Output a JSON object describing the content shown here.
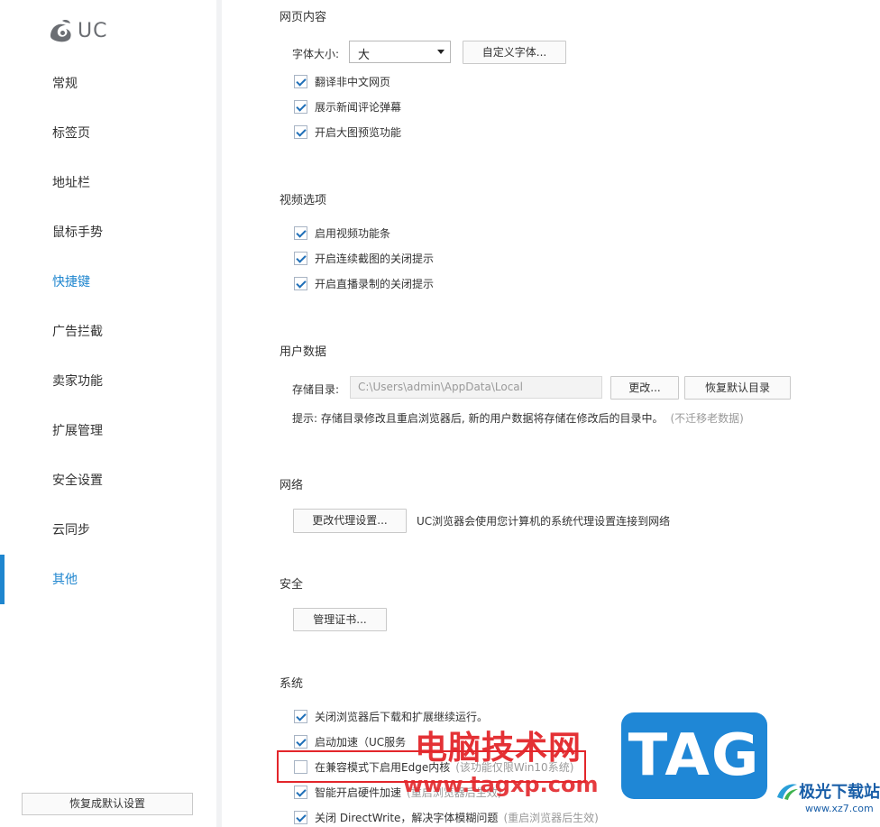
{
  "sidebar": {
    "logo_text": "UC",
    "items": [
      {
        "label": "常规"
      },
      {
        "label": "标签页"
      },
      {
        "label": "地址栏"
      },
      {
        "label": "鼠标手势"
      },
      {
        "label": "快捷键"
      },
      {
        "label": "广告拦截"
      },
      {
        "label": "卖家功能"
      },
      {
        "label": "扩展管理"
      },
      {
        "label": "安全设置"
      },
      {
        "label": "云同步"
      },
      {
        "label": "其他"
      }
    ],
    "active_item": "其他",
    "reset_button": "恢复成默认设置"
  },
  "webpage": {
    "title": "网页内容",
    "font_size_label": "字体大小:",
    "font_size_value": "大",
    "custom_font_button": "自定义字体...",
    "options": [
      {
        "label": "翻译非中文网页",
        "checked": true
      },
      {
        "label": "展示新闻评论弹幕",
        "checked": true
      },
      {
        "label": "开启大图预览功能",
        "checked": true
      }
    ]
  },
  "video": {
    "title": "视频选项",
    "options": [
      {
        "label": "启用视频功能条",
        "checked": true
      },
      {
        "label": "开启连续截图的关闭提示",
        "checked": true
      },
      {
        "label": "开启直播录制的关闭提示",
        "checked": true
      }
    ]
  },
  "userdata": {
    "title": "用户数据",
    "storage_label": "存储目录:",
    "storage_path": "C:\\Users\\admin\\AppData\\Local",
    "change_button": "更改...",
    "restore_button": "恢复默认目录",
    "hint": "提示: 存储目录修改且重启浏览器后, 新的用户数据将存储在修改后的目录中。",
    "hint_note": "(不迁移老数据)"
  },
  "network": {
    "title": "网络",
    "proxy_button": "更改代理设置...",
    "proxy_desc": "UC浏览器会使用您计算机的系统代理设置连接到网络"
  },
  "security": {
    "title": "安全",
    "cert_button": "管理证书..."
  },
  "system": {
    "title": "系统",
    "options": [
      {
        "label": "关闭浏览器后下载和扩展继续运行。",
        "note": "",
        "checked": true
      },
      {
        "label": "启动加速（UC服务",
        "note": "",
        "checked": true
      },
      {
        "label": "在兼容模式下启用Edge内核",
        "note": "(该功能仅限Win10系统)",
        "checked": false
      },
      {
        "label": "智能开启硬件加速",
        "note": "(重启浏览器后生效)",
        "checked": true
      },
      {
        "label": "关闭 DirectWrite，解决字体模糊问题",
        "note": "(重启浏览器后生效)",
        "checked": true
      }
    ]
  },
  "watermark": {
    "title": "电脑技术网",
    "url": "www.tagxp.com",
    "tag": "TAG",
    "site_name": "极光下载站",
    "site_url": "www.xz7.com"
  },
  "colors": {
    "accent": "#1f86cf",
    "watermark_red": "#e3262b",
    "tag_blue": "#1f87d6"
  }
}
